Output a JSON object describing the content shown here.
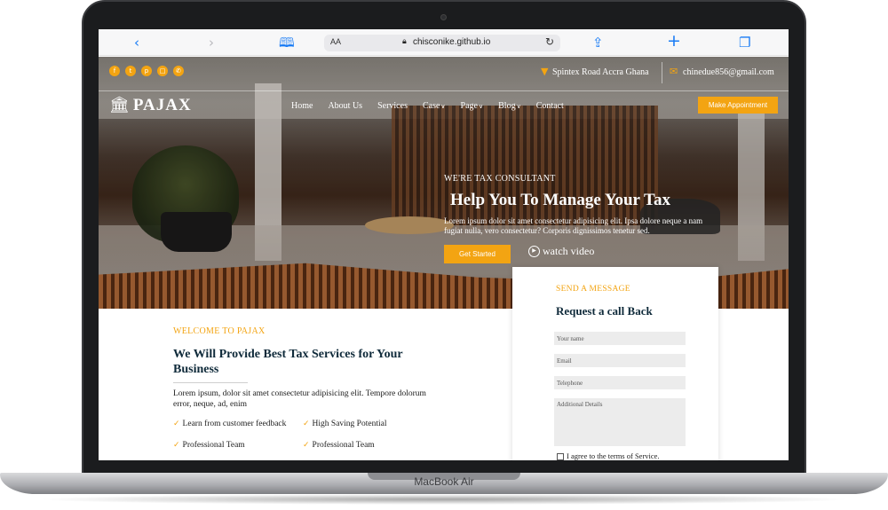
{
  "device": {
    "label": "MacBook Air"
  },
  "browser": {
    "reader_label": "AA",
    "url": "chisconike.github.io",
    "icons": [
      "chevron-left-icon",
      "chevron-right-icon",
      "book-icon",
      "lock-icon",
      "reload-icon",
      "share-icon",
      "plus-icon",
      "tabs-icon"
    ]
  },
  "topbar": {
    "social_icons": [
      "facebook-icon",
      "twitter-icon",
      "pinterest-icon",
      "instagram-icon",
      "whatsapp-icon"
    ],
    "location": "Spintex Road Accra Ghana",
    "email": "chinedue856@gmail.com"
  },
  "brand": {
    "name": "PAJAX"
  },
  "nav": {
    "items": [
      {
        "label": "Home",
        "dropdown": false
      },
      {
        "label": "About Us",
        "dropdown": false
      },
      {
        "label": "Services",
        "dropdown": false
      },
      {
        "label": "Case",
        "dropdown": true
      },
      {
        "label": "Page",
        "dropdown": true
      },
      {
        "label": "Blog",
        "dropdown": true
      },
      {
        "label": "Contact",
        "dropdown": false
      }
    ],
    "appointment_button": "Make Appointment"
  },
  "hero": {
    "tag": "WE'RE TAX CONSULTANT",
    "headline": "Help You To Manage Your Tax",
    "description": "Lorem ipsum dolor sit amet consectetur adipisicing elit. Ipsa dolore neque a nam fugiat nulla, vero consectetur? Corporis dignissimos tenetur sed.",
    "cta_button": "Get Started",
    "video_link": "watch video"
  },
  "welcome": {
    "label": "WELCOME TO PAJAX",
    "title": "We Will Provide Best Tax Services for Your Business",
    "text": "Lorem ipsum, dolor sit amet consectetur adipisicing elit. Tempore dolorum error, neque, ad, enim",
    "features": [
      "Learn from customer feedback",
      "High Saving Potential",
      "Professional Team",
      "Professional Team"
    ]
  },
  "contact_form": {
    "label": "SEND A MESSAGE",
    "title": "Request a call Back",
    "fields": {
      "name_placeholder": "Your name",
      "email_placeholder": "Email",
      "phone_placeholder": "Telephone",
      "details_placeholder": "Additional Details"
    },
    "terms_label": "I agree to the terms of Service."
  },
  "colors": {
    "accent": "#f3a412",
    "heading": "#0f2a3a"
  }
}
